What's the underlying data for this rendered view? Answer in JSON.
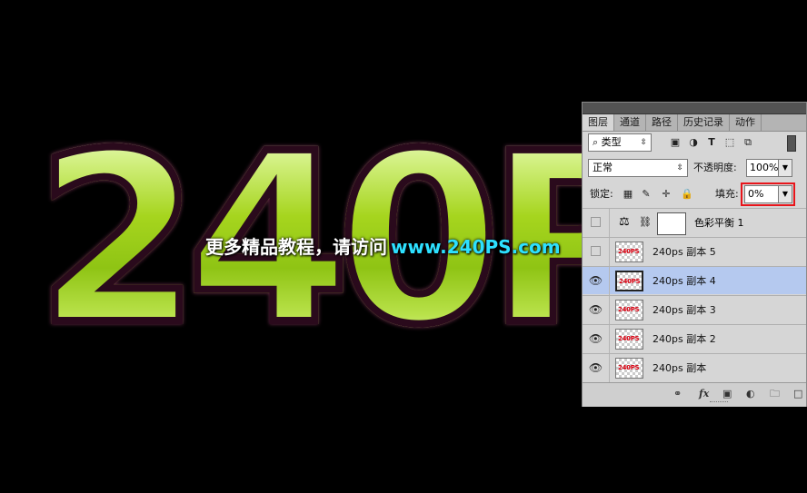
{
  "canvas": {
    "art_text": "240P",
    "watermark_cn": "更多精品教程，请访问",
    "watermark_site": "www.240PS.com"
  },
  "panel": {
    "tabs": [
      "图层",
      "通道",
      "路径",
      "历史记录",
      "动作"
    ],
    "active_tab": 0,
    "filter_type": "类型",
    "blend_mode": "正常",
    "opacity_label": "不透明度:",
    "opacity_value": "100%",
    "lock_label": "锁定:",
    "fill_label": "填充:",
    "fill_value": "0%",
    "highlight_color": "#e8151b",
    "adjustment_layer": {
      "name": "色彩平衡 1"
    },
    "layers": [
      {
        "name": "240ps 副本 5",
        "thumb": "240PS",
        "visible": false,
        "selected": false
      },
      {
        "name": "240ps 副本 4",
        "thumb": "240PS",
        "visible": true,
        "selected": true
      },
      {
        "name": "240ps 副本 3",
        "thumb": "240PS",
        "visible": true,
        "selected": false
      },
      {
        "name": "240ps 副本 2",
        "thumb": "240PS",
        "visible": true,
        "selected": false
      },
      {
        "name": "240ps 副本",
        "thumb": "240PS",
        "visible": true,
        "selected": false
      }
    ],
    "selected_color": "#b5c9ef"
  }
}
